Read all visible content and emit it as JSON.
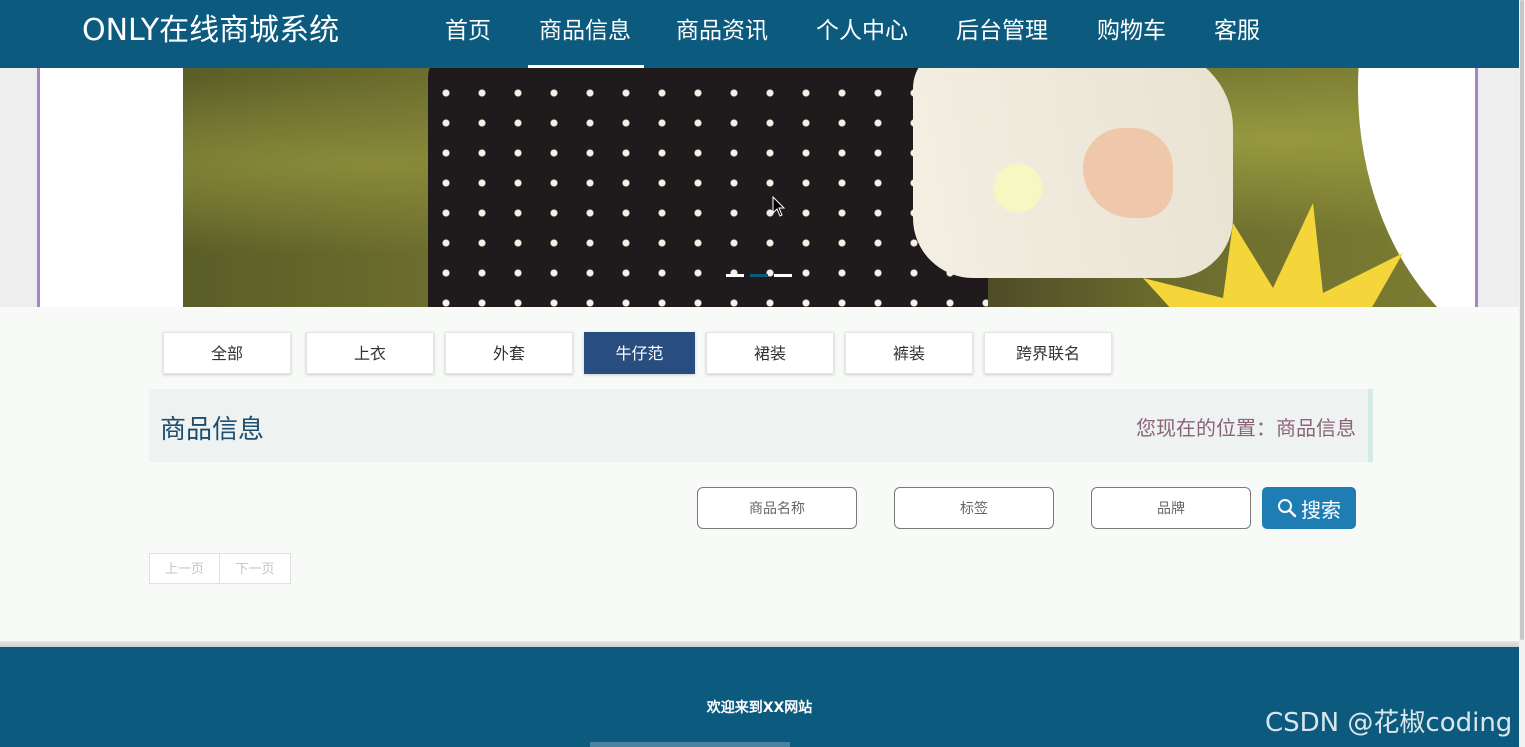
{
  "header": {
    "brand": "ONLY在线商城系统",
    "nav": [
      {
        "label": "首页"
      },
      {
        "label": "商品信息",
        "active": true
      },
      {
        "label": "商品资讯"
      },
      {
        "label": "个人中心"
      },
      {
        "label": "后台管理"
      },
      {
        "label": "购物车"
      },
      {
        "label": "客服"
      }
    ]
  },
  "carousel": {
    "slide_count": 3,
    "active_index": 1
  },
  "categories": [
    {
      "label": "全部"
    },
    {
      "label": "上衣"
    },
    {
      "label": "外套"
    },
    {
      "label": "牛仔范",
      "active": true
    },
    {
      "label": "裙装"
    },
    {
      "label": "裤装"
    },
    {
      "label": "跨界联名"
    }
  ],
  "section": {
    "title": "商品信息",
    "location": "您现在的位置：商品信息"
  },
  "search": {
    "name_placeholder": "商品名称",
    "tag_placeholder": "标签",
    "brand_placeholder": "品牌",
    "button_label": "搜索"
  },
  "pagination": {
    "prev_label": "上一页",
    "next_label": "下一页"
  },
  "footer": {
    "text": "欢迎来到XX网站"
  },
  "watermark": "CSDN @花椒coding",
  "colors": {
    "primary": "#0d5a7f",
    "active_category": "#2a4d7f",
    "search_button": "#1e7db3",
    "location_text": "#8a6478",
    "frame_accent": "#a585c8"
  }
}
